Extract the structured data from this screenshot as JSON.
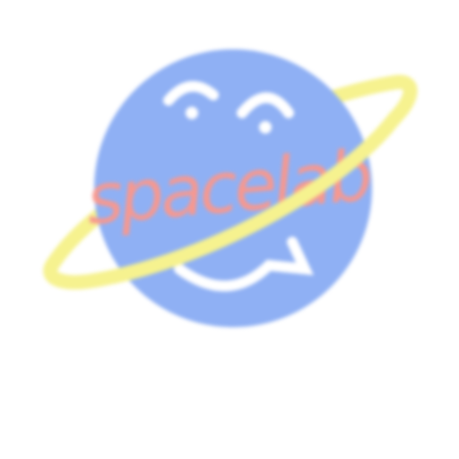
{
  "logo": {
    "wordmark": "spacelab",
    "colors": {
      "planet": "#8fb0f4",
      "ring": "#f6f28f",
      "wordmark": "#f7988f",
      "face": "#ffffff",
      "background": "#ffffff"
    },
    "icons": [
      "planet-icon",
      "ring-icon",
      "smiley-face-icon"
    ]
  }
}
